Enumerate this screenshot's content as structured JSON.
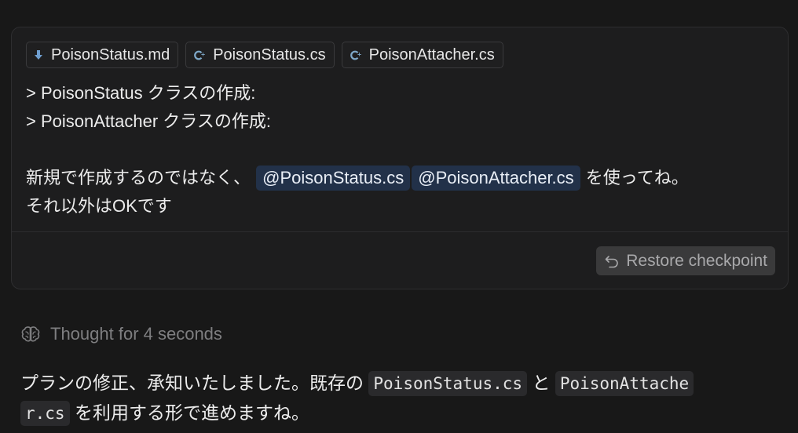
{
  "attachments": [
    {
      "name": "PoisonStatus.md",
      "icon": "markdown-icon"
    },
    {
      "name": "PoisonStatus.cs",
      "icon": "csharp-icon"
    },
    {
      "name": "PoisonAttacher.cs",
      "icon": "csharp-icon"
    }
  ],
  "message": {
    "line1": "> PoisonStatus クラスの作成:",
    "line2": "> PoisonAttacher クラスの作成:",
    "line4_pre": "新規で作成するのではなく、",
    "mention1": "@PoisonStatus.cs",
    "mention2": "@PoisonAttacher.cs",
    "line4_post": "を使ってね。",
    "line5": "それ以外はOKです"
  },
  "restore_label": "Restore checkpoint",
  "thought_label": "Thought for 4 seconds",
  "reply": {
    "part1": "プランの修正、承知いたしました。既存の",
    "code1": "PoisonStatus.cs",
    "part2": "と",
    "code2a": "PoisonAttache",
    "code2b": "r.cs",
    "part3": "を利用する形で進めますね。"
  },
  "colors": {
    "background": "#181818",
    "card": "#1d1d1e",
    "mention_bg": "#223149",
    "csharp_icon": "#7fa9c9",
    "markdown_icon": "#6f9fd0"
  }
}
